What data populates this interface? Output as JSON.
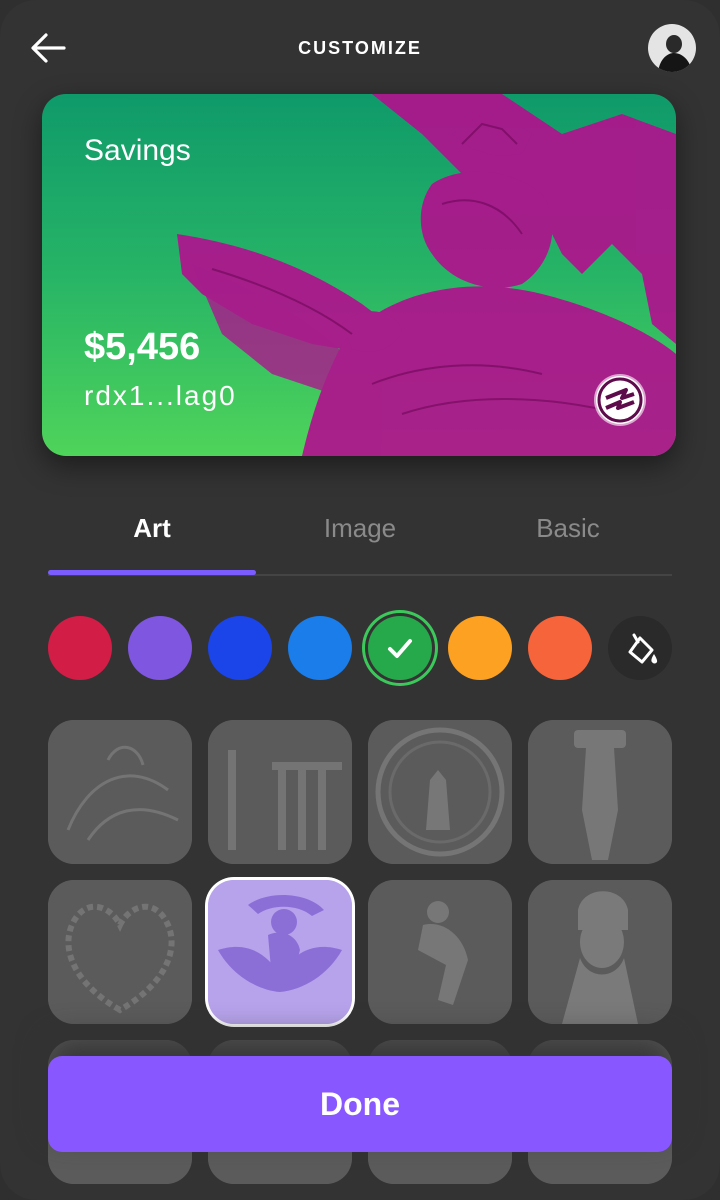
{
  "header": {
    "title": "CUSTOMIZE",
    "back_icon": "arrow-left-icon",
    "avatar_icon": "avatar"
  },
  "card": {
    "name": "Savings",
    "balance": "$5,456",
    "address": "rdx1...lag0",
    "colors": {
      "gradient_top": "#0f9a6a",
      "gradient_bottom": "#4fd45a",
      "art": "#b0128e"
    },
    "logo_icon": "radix-logo-icon"
  },
  "tabs": [
    {
      "label": "Art",
      "active": true
    },
    {
      "label": "Image",
      "active": false
    },
    {
      "label": "Basic",
      "active": false
    }
  ],
  "swatches": [
    {
      "color": "#d21d47",
      "selected": false
    },
    {
      "color": "#7e56df",
      "selected": false
    },
    {
      "color": "#1b45e8",
      "selected": false
    },
    {
      "color": "#1a7de9",
      "selected": false
    },
    {
      "color": "#26a94a",
      "selected": true
    },
    {
      "color": "#fca121",
      "selected": false
    },
    {
      "color": "#f5643a",
      "selected": false
    }
  ],
  "paint_icon": "paint-bucket-icon",
  "art_thumbnails": [
    {
      "name": "angel-engraving",
      "selected": false
    },
    {
      "name": "temple-ruins",
      "selected": false
    },
    {
      "name": "medallion",
      "selected": false
    },
    {
      "name": "atlas-statue",
      "selected": false
    },
    {
      "name": "floral-wreath",
      "selected": false
    },
    {
      "name": "zeus-eagle",
      "selected": true
    },
    {
      "name": "dancing-figure",
      "selected": false
    },
    {
      "name": "bearded-bust",
      "selected": false
    }
  ],
  "done_label": "Done"
}
